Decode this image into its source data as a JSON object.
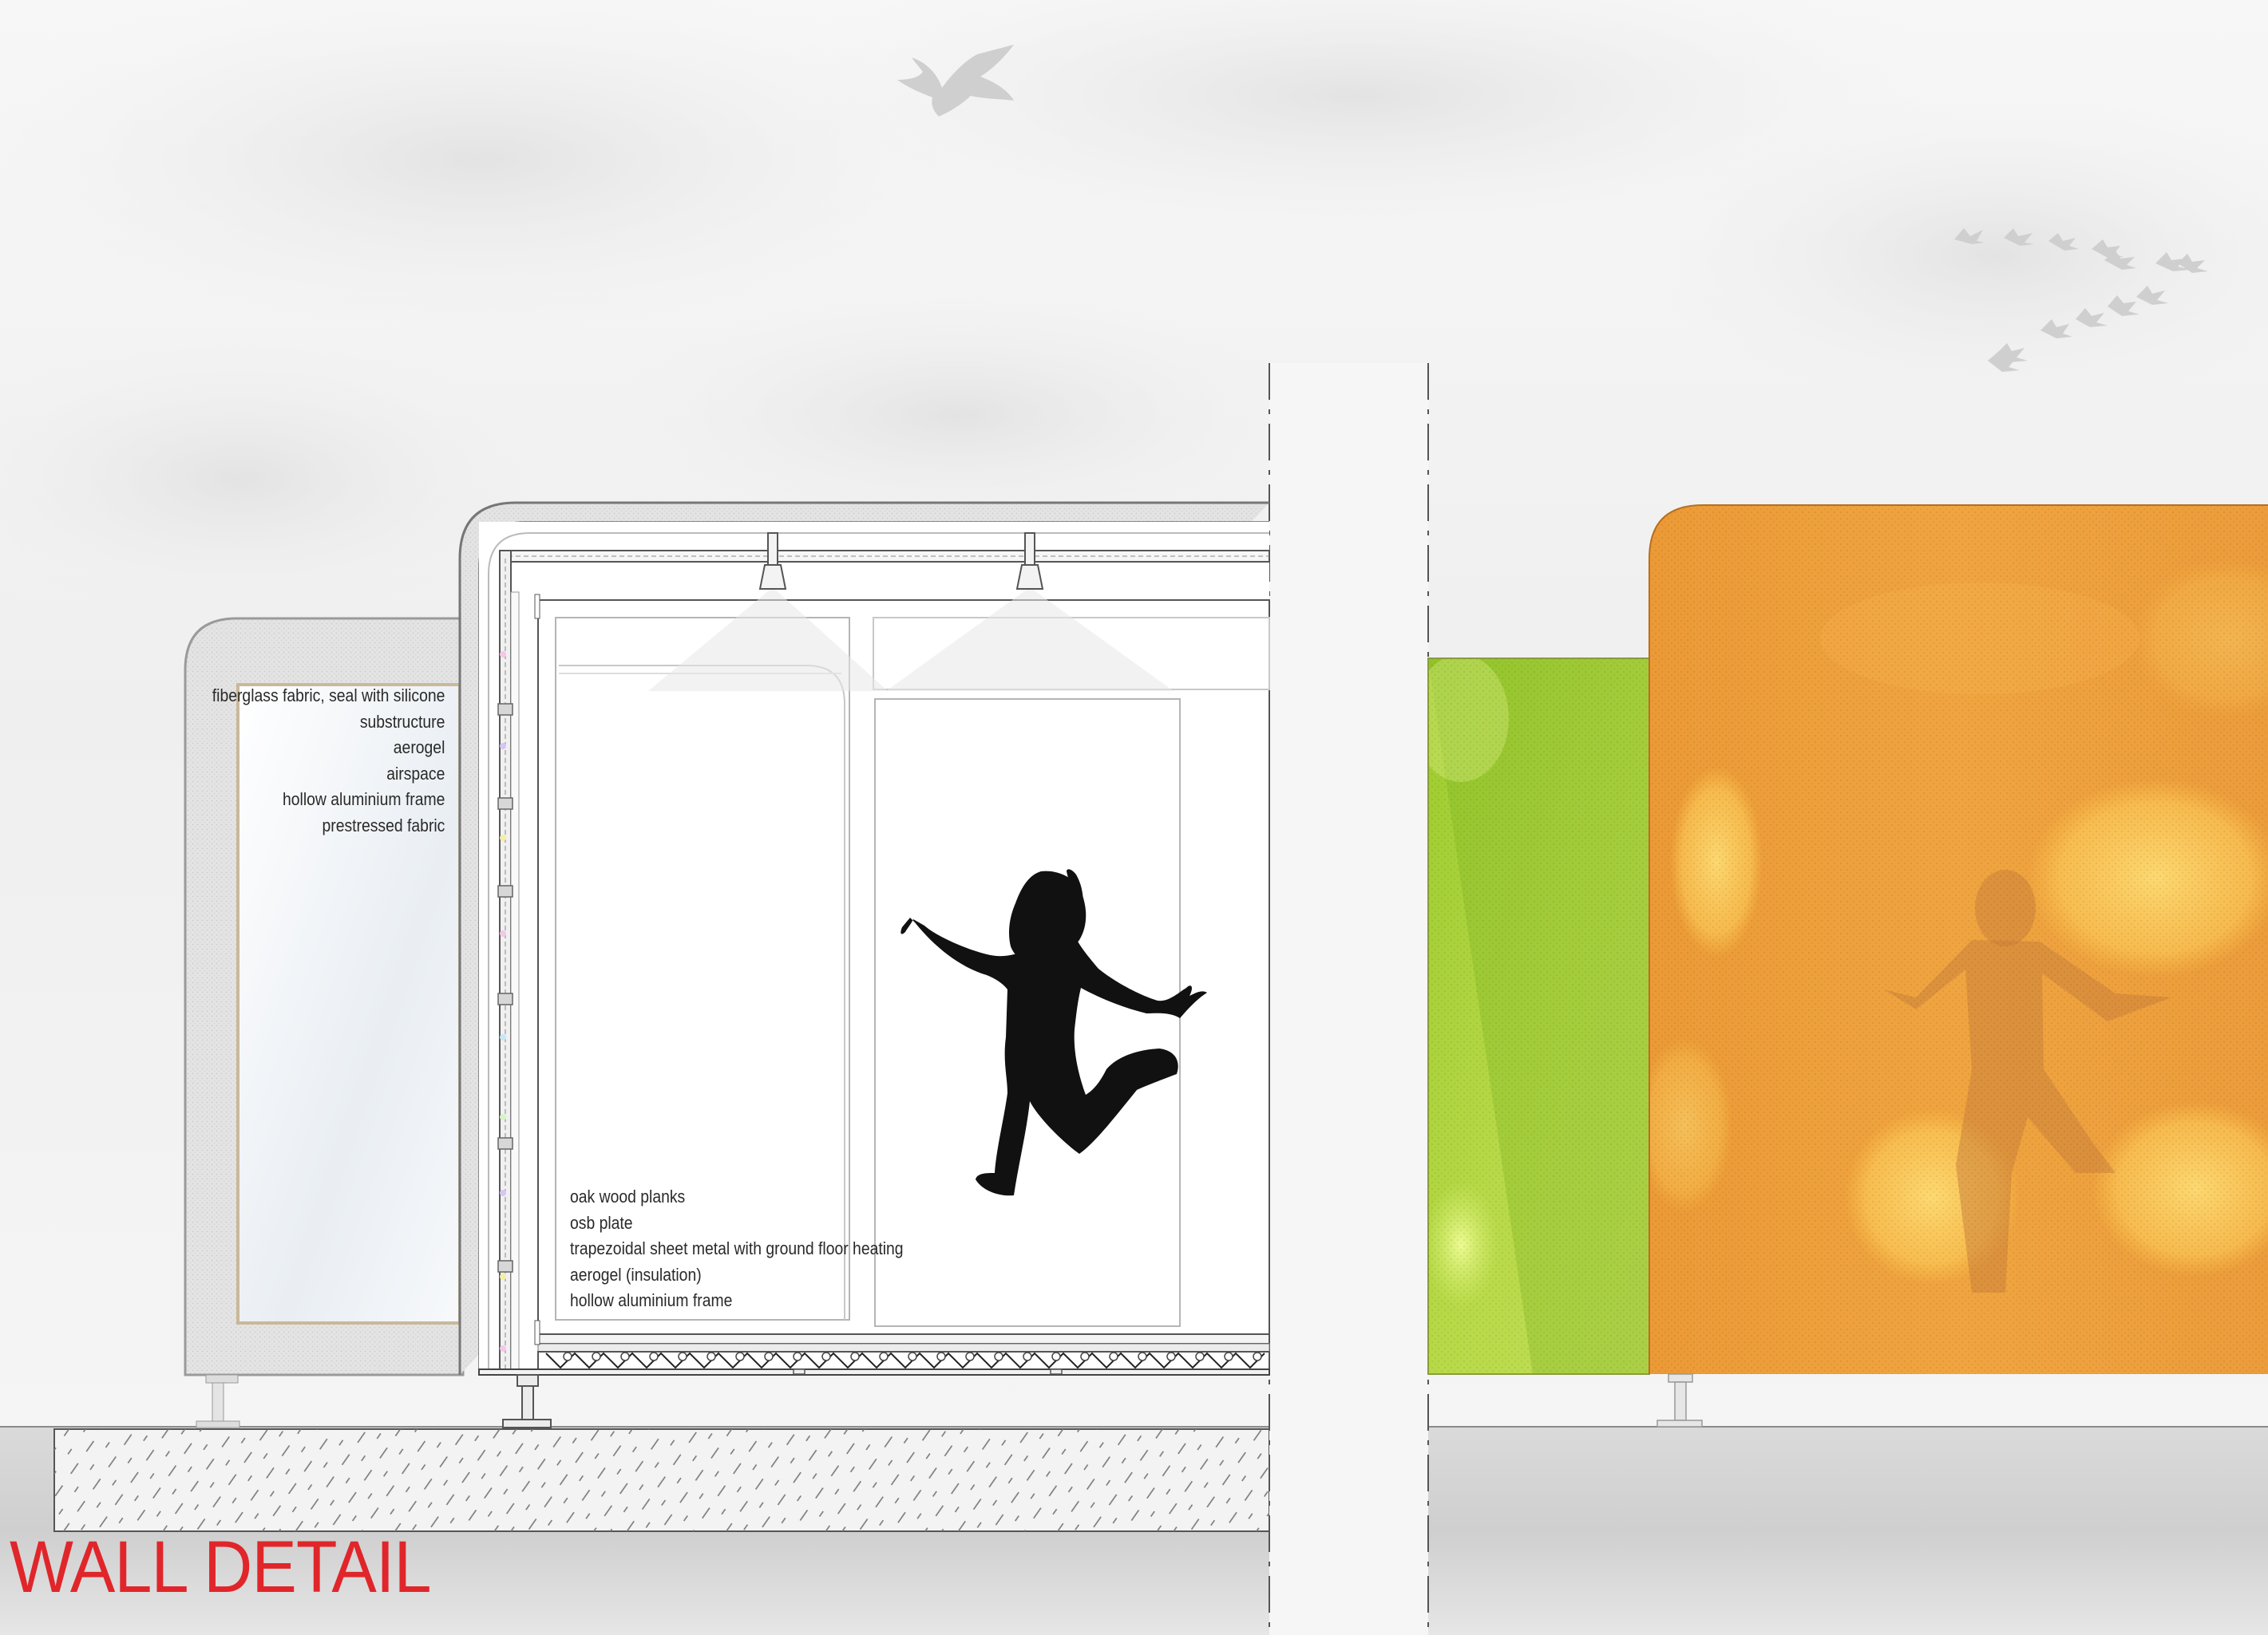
{
  "wall_layers": [
    "fiberglass  fabric, seal with silicone",
    "substructure",
    "aerogel",
    "airspace",
    "hollow aluminium frame",
    "prestressed fabric"
  ],
  "floor_layers": [
    "oak wood planks",
    "osb plate",
    "trapezoidal sheet metal with ground floor heating",
    "aerogel (insulation)",
    "hollow aluminium frame"
  ],
  "title": "WALL DETAIL",
  "colors": {
    "title": "#e0262a",
    "sky": "#f3f3f3",
    "ground": "#d4d4d4",
    "green_panel": "#b3d640",
    "orange_panel": "#f0a23c",
    "silhouette": "#111111"
  },
  "icons": [
    "bird-icon",
    "bird-flock-icon",
    "dancer-silhouette-icon"
  ]
}
